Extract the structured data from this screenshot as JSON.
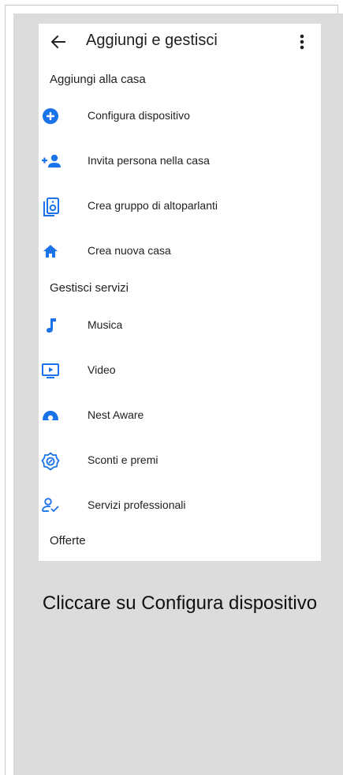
{
  "appbar": {
    "title": "Aggiungi e gestisci",
    "back_icon": "arrow-left-icon",
    "more_icon": "more-vert-icon"
  },
  "sections": {
    "add_home": "Aggiungi alla casa",
    "manage_services": "Gestisci servizi",
    "offers": "Offerte"
  },
  "add_items": [
    {
      "label": "Configura dispositivo",
      "icon": "add-circle-icon"
    },
    {
      "label": "Invita persona nella casa",
      "icon": "person-add-icon"
    },
    {
      "label": "Crea gruppo di altoparlanti",
      "icon": "speaker-group-icon"
    },
    {
      "label": "Crea nuova casa",
      "icon": "home-icon"
    }
  ],
  "service_items": [
    {
      "label": "Musica",
      "icon": "music-note-icon"
    },
    {
      "label": "Video",
      "icon": "video-icon"
    },
    {
      "label": "Nest Aware",
      "icon": "nest-aware-icon"
    },
    {
      "label": "Sconti e premi",
      "icon": "offer-badge-icon"
    },
    {
      "label": "Servizi professionali",
      "icon": "person-check-icon"
    }
  ],
  "caption": "Cliccare su Configura dispositivo",
  "colors": {
    "accent": "#1a73e8",
    "text": "#202124",
    "panel": "#dcdcdc"
  }
}
